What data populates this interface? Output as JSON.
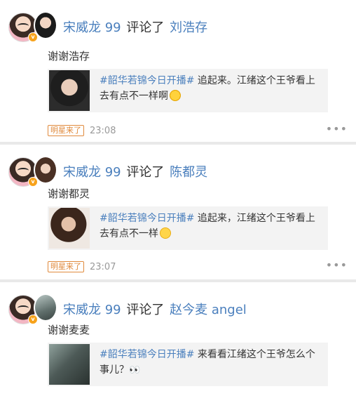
{
  "comments": [
    {
      "user": "宋威龙 99",
      "action": "评论了",
      "target": "刘浩存",
      "reply": "谢谢浩存",
      "quote_tag": "#韶华若锦今日开播#",
      "quote_text": " 追起来。江绪这个王爷看上去有点不一样啊",
      "emoji": "thinking-emoji",
      "source_tag": "明星来了",
      "time": "23:08",
      "more": "•••"
    },
    {
      "user": "宋威龙 99",
      "action": "评论了",
      "target": "陈都灵",
      "reply": "谢谢都灵",
      "quote_tag": "#韶华若锦今日开播#",
      "quote_text": " 追起来，江绪这个王爷看上去有点不一样",
      "emoji": "smile-emoji",
      "source_tag": "明星来了",
      "time": "23:07",
      "more": "•••"
    },
    {
      "user": "宋威龙 99",
      "action": "评论了",
      "target": "赵今麦 angel",
      "reply": "谢谢麦麦",
      "quote_tag": "#韶华若锦今日开播#",
      "quote_text": " 来看看江绪这个王爷怎么个事儿？",
      "emoji": "eyes-emoji",
      "eyes_glyph": "👀"
    }
  ],
  "badge_glyph": "v"
}
